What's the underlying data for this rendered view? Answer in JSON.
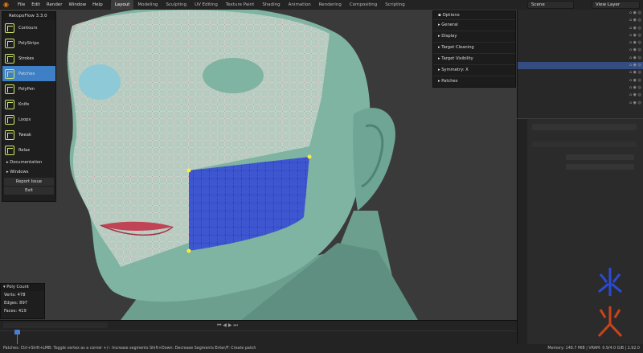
{
  "menubar": {
    "items": [
      "File",
      "Edit",
      "Render",
      "Window",
      "Help"
    ],
    "workspaces": [
      "Layout",
      "Modeling",
      "Sculpting",
      "UV Editing",
      "Texture Paint",
      "Shading",
      "Animation",
      "Rendering",
      "Compositing",
      "Scripting"
    ],
    "active_workspace": "Layout",
    "scene_label": "Scene",
    "view_layer_label": "View Layer"
  },
  "retopoflow": {
    "title": "RetopoFlow 3.3.0",
    "tools": [
      {
        "label": "Contours",
        "active": false
      },
      {
        "label": "PolyStrips",
        "active": false
      },
      {
        "label": "Strokes",
        "active": false
      },
      {
        "label": "Patches",
        "active": true
      },
      {
        "label": "PolyPen",
        "active": false
      },
      {
        "label": "Knife",
        "active": false
      },
      {
        "label": "Loops",
        "active": false
      },
      {
        "label": "Tweak",
        "active": false
      },
      {
        "label": "Relax",
        "active": false
      }
    ],
    "documentation_label": "Documentation",
    "windows_label": "Windows",
    "report_issue_label": "Report Issue",
    "exit_label": "Exit"
  },
  "poly_count": {
    "title": "Poly Count",
    "verts_label": "Verts:",
    "verts": "478",
    "edges_label": "Edges:",
    "edges": "897",
    "faces_label": "Faces:",
    "faces": "419"
  },
  "options": {
    "title": "Options",
    "items": [
      "General",
      "Display",
      "Target Cleaning",
      "Target Visibility",
      "Symmetry: X",
      "Patches"
    ]
  },
  "statusbar": {
    "left": "Patches: Ctrl+Shift+LMB: Toggle vertex as a corner   +/-: Increase segments   Shift+Down: Decrease Segments   Enter/F: Create patch",
    "right": "Memory: 148.7 MiB | VRAM: 0.9/4.0 GiB | 2.92.0"
  },
  "colors": {
    "accent": "#3e7fc5",
    "patch_blue": "#3346d8",
    "head_green": "#7fb3a2",
    "tool_icon": "#cfe86a"
  }
}
